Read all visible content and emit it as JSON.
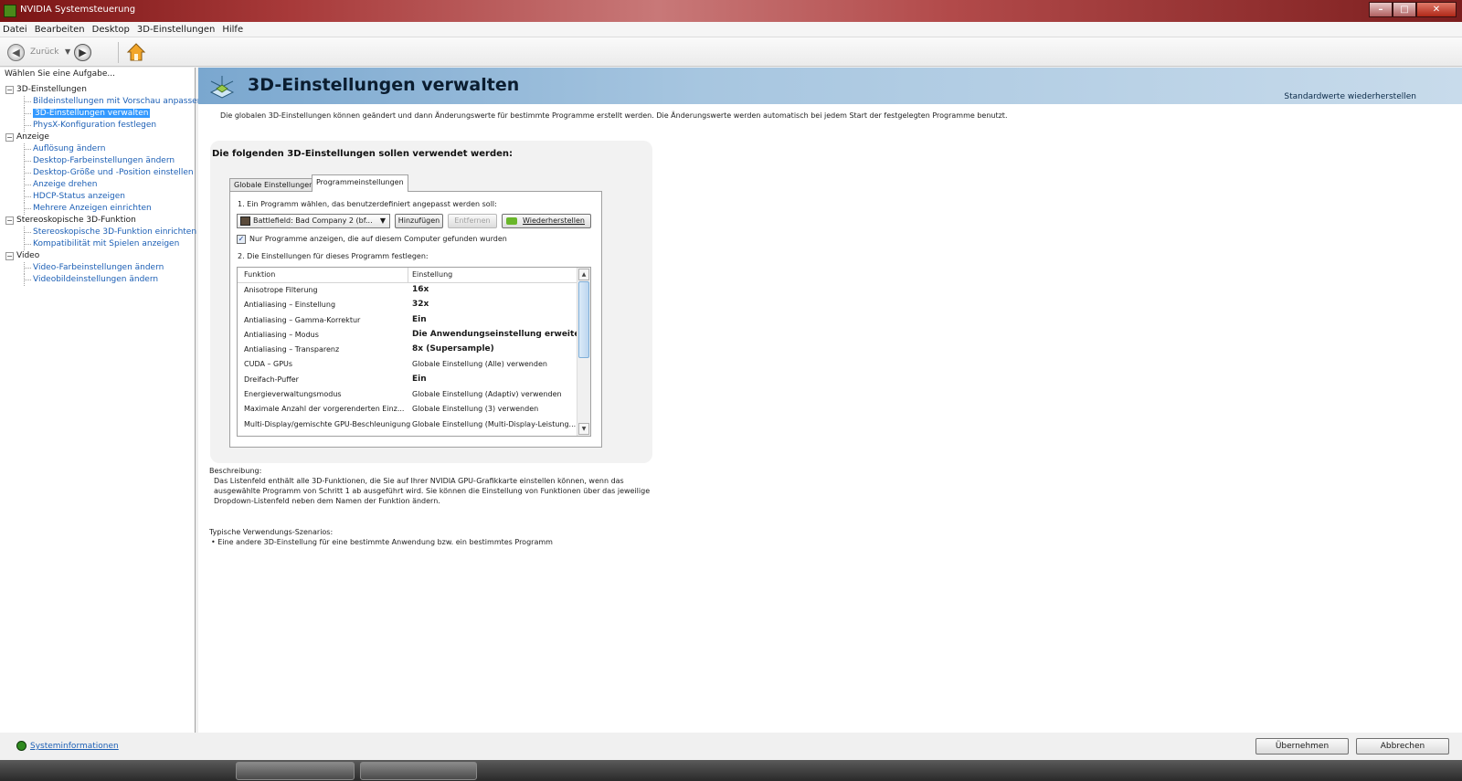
{
  "window": {
    "title": "NVIDIA Systemsteuerung"
  },
  "menu": [
    "Datei",
    "Bearbeiten",
    "Desktop",
    "3D-Einstellungen",
    "Hilfe"
  ],
  "toolbar": {
    "back_label": "Zurück"
  },
  "sidebar": {
    "heading": "Wählen Sie eine Aufgabe...",
    "categories": [
      {
        "label": "3D-Einstellungen",
        "items": [
          "Bildeinstellungen mit Vorschau anpassen",
          "3D-Einstellungen verwalten",
          "PhysX-Konfiguration festlegen"
        ]
      },
      {
        "label": "Anzeige",
        "items": [
          "Auflösung ändern",
          "Desktop-Farbeinstellungen ändern",
          "Desktop-Größe und -Position einstellen",
          "Anzeige drehen",
          "HDCP-Status anzeigen",
          "Mehrere Anzeigen einrichten"
        ]
      },
      {
        "label": "Stereoskopische 3D-Funktion",
        "items": [
          "Stereoskopische 3D-Funktion einrichten",
          "Kompatibilität mit Spielen anzeigen"
        ]
      },
      {
        "label": "Video",
        "items": [
          "Video-Farbeinstellungen ändern",
          "Videobildeinstellungen ändern"
        ]
      }
    ],
    "selected": "3D-Einstellungen verwalten"
  },
  "main": {
    "title": "3D-Einstellungen verwalten",
    "restore_defaults": "Standardwerte wiederherstellen",
    "intro": "Die globalen 3D-Einstellungen können geändert und dann Änderungswerte für bestimmte Programme erstellt werden. Die Änderungswerte werden automatisch bei jedem Start der festgelegten Programme benutzt.",
    "panel_title": "Die folgenden 3D-Einstellungen sollen verwendet werden:",
    "tabs": [
      "Globale Einstellungen",
      "Programmeinstellungen"
    ],
    "active_tab": "Programmeinstellungen",
    "step1": "1. Ein Programm wählen, das benutzerdefiniert angepasst werden soll:",
    "program_selected": "Battlefield: Bad Company 2 (bf...",
    "btn_add": "Hinzufügen",
    "btn_remove": "Entfernen",
    "btn_restore": "Wiederherstellen",
    "checkbox_label": "Nur Programme anzeigen, die auf diesem Computer gefunden wurden",
    "checkbox_checked": true,
    "step2": "2. Die Einstellungen für dieses Programm festlegen:",
    "table": {
      "headers": [
        "Funktion",
        "Einstellung"
      ],
      "rows": [
        {
          "f": "Anisotrope Filterung",
          "v": "16x",
          "bold": true
        },
        {
          "f": "Antialiasing – Einstellung",
          "v": "32x",
          "bold": true
        },
        {
          "f": "Antialiasing – Gamma-Korrektur",
          "v": "Ein",
          "bold": true
        },
        {
          "f": "Antialiasing – Modus",
          "v": "Die Anwendungseinstellung erweitern",
          "bold": true
        },
        {
          "f": "Antialiasing – Transparenz",
          "v": "8x (Supersample)",
          "bold": true
        },
        {
          "f": "CUDA – GPUs",
          "v": "Globale Einstellung (Alle) verwenden",
          "bold": false
        },
        {
          "f": "Dreifach-Puffer",
          "v": "Ein",
          "bold": true
        },
        {
          "f": "Energieverwaltungsmodus",
          "v": "Globale Einstellung (Adaptiv) verwenden",
          "bold": false
        },
        {
          "f": "Maximale Anzahl der vorgerenderten Einz...",
          "v": "Globale Einstellung (3) verwenden",
          "bold": false
        },
        {
          "f": "Multi-Display/gemischte GPU-Beschleunigung",
          "v": "Globale Einstellung (Multi-Display-Leistung...",
          "bold": false
        }
      ]
    },
    "description_heading": "Beschreibung:",
    "description_lines": [
      "Das Listenfeld enthält alle 3D-Funktionen, die Sie auf Ihrer NVIDIA GPU-Grafikkarte einstellen können, wenn das",
      "ausgewählte Programm von Schritt 1 ab ausgeführt wird. Sie können die Einstellung von Funktionen über das jeweilige",
      "Dropdown-Listenfeld neben dem Namen der Funktion ändern."
    ],
    "scenarios_heading": "Typische Verwendungs-Szenarios:",
    "scenarios": [
      "• Eine andere 3D-Einstellung für eine bestimmte Anwendung bzw. ein bestimmtes Programm"
    ]
  },
  "footer": {
    "sysinfo": "Systeminformationen",
    "apply": "Übernehmen",
    "cancel": "Abbrechen"
  }
}
